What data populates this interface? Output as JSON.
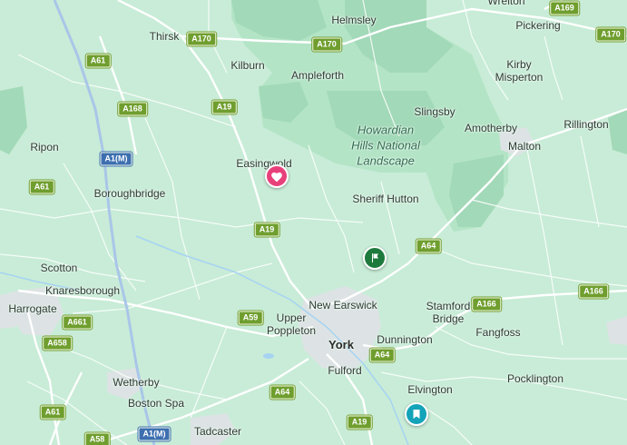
{
  "map": {
    "places": [
      {
        "id": "thirsk",
        "name": "Thirsk"
      },
      {
        "id": "helmsley",
        "name": "Helmsley"
      },
      {
        "id": "pickering",
        "name": "Pickering"
      },
      {
        "id": "wrelton",
        "name": "Wrelton"
      },
      {
        "id": "kilburn",
        "name": "Kilburn"
      },
      {
        "id": "ampleforth",
        "name": "Ampleforth"
      },
      {
        "id": "kirby-misperton",
        "name": "Kirby\nMisperton"
      },
      {
        "id": "slingsby",
        "name": "Slingsby"
      },
      {
        "id": "amotherby",
        "name": "Amotherby"
      },
      {
        "id": "rillington",
        "name": "Rillington"
      },
      {
        "id": "ripon",
        "name": "Ripon"
      },
      {
        "id": "malton",
        "name": "Malton"
      },
      {
        "id": "easingwold",
        "name": "Easingwold"
      },
      {
        "id": "boroughbridge",
        "name": "Boroughbridge"
      },
      {
        "id": "sheriff-hutton",
        "name": "Sheriff Hutton"
      },
      {
        "id": "scotton",
        "name": "Scotton"
      },
      {
        "id": "knaresborough",
        "name": "Knaresborough"
      },
      {
        "id": "harrogate",
        "name": "Harrogate"
      },
      {
        "id": "new-earswick",
        "name": "New Earswick"
      },
      {
        "id": "upper-poppleton",
        "name": "Upper\nPoppleton"
      },
      {
        "id": "stamford-bridge",
        "name": "Stamford\nBridge"
      },
      {
        "id": "fangfoss",
        "name": "Fangfoss"
      },
      {
        "id": "york",
        "name": "York"
      },
      {
        "id": "dunnington",
        "name": "Dunnington"
      },
      {
        "id": "fulford",
        "name": "Fulford"
      },
      {
        "id": "wetherby",
        "name": "Wetherby"
      },
      {
        "id": "elvington",
        "name": "Elvington"
      },
      {
        "id": "pocklington",
        "name": "Pocklington"
      },
      {
        "id": "boston-spa",
        "name": "Boston Spa"
      },
      {
        "id": "tadcaster",
        "name": "Tadcaster"
      }
    ],
    "park_name": "Howardian\nHills National\nLandscape",
    "roads": [
      {
        "id": "a169",
        "label": "A169"
      },
      {
        "id": "a170-a",
        "label": "A170"
      },
      {
        "id": "a170-b",
        "label": "A170"
      },
      {
        "id": "a170-c",
        "label": "A170"
      },
      {
        "id": "a61-a",
        "label": "A61"
      },
      {
        "id": "a168",
        "label": "A168"
      },
      {
        "id": "a19-a",
        "label": "A19"
      },
      {
        "id": "a1m-a",
        "label": "A1(M)"
      },
      {
        "id": "a61-b",
        "label": "A61"
      },
      {
        "id": "a19-b",
        "label": "A19"
      },
      {
        "id": "a64-a",
        "label": "A64"
      },
      {
        "id": "a166-a",
        "label": "A166"
      },
      {
        "id": "a166-b",
        "label": "A166"
      },
      {
        "id": "a661",
        "label": "A661"
      },
      {
        "id": "a59",
        "label": "A59"
      },
      {
        "id": "a658",
        "label": "A658"
      },
      {
        "id": "a64-b",
        "label": "A64"
      },
      {
        "id": "a64-c",
        "label": "A64"
      },
      {
        "id": "a61-c",
        "label": "A61"
      },
      {
        "id": "a1m-b",
        "label": "A1(M)"
      },
      {
        "id": "a19-c",
        "label": "A19"
      },
      {
        "id": "a58",
        "label": "A58"
      }
    ],
    "markers": [
      {
        "id": "favorite",
        "icon": "heart-icon",
        "color": "#e8407a"
      },
      {
        "id": "flag",
        "icon": "flag-icon",
        "color": "#1e7a3c"
      },
      {
        "id": "bookmark",
        "icon": "bookmark-icon",
        "color": "#14a3b8"
      }
    ],
    "colors": {
      "land": "#c8ecd7",
      "forest": "#9fdcb6",
      "park": "#b0e3c3",
      "urban": "#dfe3e6",
      "road": "#ffffff",
      "motorway": "#a9c6e8",
      "water": "#a6d3f2"
    }
  }
}
